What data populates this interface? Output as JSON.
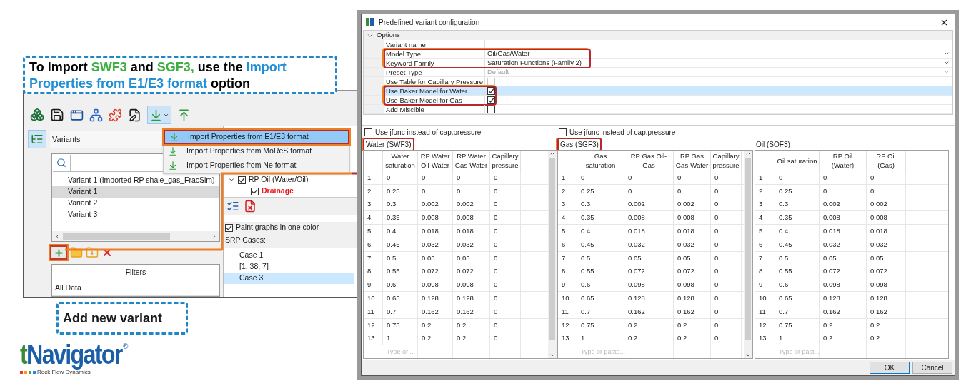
{
  "import_callout": {
    "segments": [
      {
        "text": "To import ",
        "color": "#000000"
      },
      {
        "text": "SWF3",
        "color": "#3cb043"
      },
      {
        "text": " and ",
        "color": "#000000"
      },
      {
        "text": "SGF3,",
        "color": "#3cb043"
      },
      {
        "text": " use the ",
        "color": "#000000"
      },
      {
        "text": "Import Properties from E1/E3 format",
        "color": "#1f8fd6"
      },
      {
        "text": " option",
        "color": "#000000"
      }
    ]
  },
  "add_callout": {
    "text": "Add new variant"
  },
  "app": {
    "import_menu": [
      {
        "label": "Import Properties from E1/E3 format",
        "selected": true
      },
      {
        "label": "Import Properties from MoReS format",
        "selected": false
      },
      {
        "label": "Import Properties from Ne format",
        "selected": false
      }
    ],
    "variants": {
      "title": "Variants",
      "items": [
        {
          "label": "Variant 1 (Imported RP shale_gas_FracSim)",
          "selected": false
        },
        {
          "label": "Variant 1",
          "selected": true
        },
        {
          "label": "Variant 2",
          "selected": false
        },
        {
          "label": "Variant 3",
          "selected": false
        }
      ],
      "add_highlighted": true
    },
    "filters": {
      "header": "Filters",
      "rows": [
        "All Data"
      ]
    },
    "tree": [
      {
        "label": "RP Oil (Water/Oil)",
        "checked": true,
        "expanded": true,
        "children": [
          {
            "label": "Drainage",
            "checked": true,
            "color": "#e8141a"
          }
        ]
      }
    ],
    "paint_one_color": {
      "label": "Paint graphs in one color",
      "checked": true
    },
    "srp_cases": {
      "title": "SRP Cases:",
      "items": [
        {
          "label": "Case 1",
          "selected": false
        },
        {
          "label": "[1, 38, 7]",
          "selected": false
        },
        {
          "label": "Case 3",
          "selected": true
        }
      ]
    }
  },
  "dialog": {
    "title": "Predefined variant configuration",
    "options": {
      "label": "Options",
      "expanded": true
    },
    "option_groups": [
      {
        "highlighted": false,
        "rows": [
          {
            "label": "Variant name",
            "kind": "text",
            "selected": false
          }
        ]
      },
      {
        "highlighted": true,
        "rows": [
          {
            "label": "Model Type",
            "kind": "dropdown",
            "value": "Oil/Gas/Water",
            "disabled": false,
            "selected": false
          },
          {
            "label": "Keyword Family",
            "kind": "dropdown",
            "value": "Saturation Functions (Family 2)",
            "disabled": false,
            "selected": false
          }
        ]
      },
      {
        "highlighted": false,
        "rows": [
          {
            "label": "Preset Type",
            "kind": "dropdown",
            "value": "Default",
            "disabled": true,
            "selected": false
          },
          {
            "label": "Use Table for Capillary Pressure",
            "kind": "checkbox",
            "checked": false,
            "disabled": true,
            "selected": false
          }
        ]
      },
      {
        "highlighted": true,
        "rows": [
          {
            "label": "Use Baker Model for Water",
            "kind": "checkbox",
            "checked": true,
            "disabled": false,
            "selected": true
          },
          {
            "label": "Use Baker Model for Gas",
            "kind": "checkbox",
            "checked": true,
            "disabled": false,
            "selected": false
          }
        ]
      },
      {
        "highlighted": false,
        "rows": [
          {
            "label": "Add Miscible",
            "kind": "checkbox",
            "checked": false,
            "disabled": false,
            "selected": false
          }
        ]
      }
    ],
    "panels": [
      {
        "jfunc": {
          "label": "Use jfunc instead of cap.pressure",
          "checked": false
        },
        "title": "Water (SWF3)",
        "highlighted": true,
        "columns": [
          "",
          "Water saturation",
          "RP Water Oil-Water",
          "RP Water Gas-Water",
          "Capillary pressure"
        ],
        "rows": [
          [
            "1",
            "0",
            "0",
            "0",
            "0"
          ],
          [
            "2",
            "0.25",
            "0",
            "0",
            "0"
          ],
          [
            "3",
            "0.3",
            "0.002",
            "0.002",
            "0"
          ],
          [
            "4",
            "0.35",
            "0.008",
            "0.008",
            "0"
          ],
          [
            "5",
            "0.4",
            "0.018",
            "0.018",
            "0"
          ],
          [
            "6",
            "0.45",
            "0.032",
            "0.032",
            "0"
          ],
          [
            "7",
            "0.5",
            "0.05",
            "0.05",
            "0"
          ],
          [
            "8",
            "0.55",
            "0.072",
            "0.072",
            "0"
          ],
          [
            "9",
            "0.6",
            "0.098",
            "0.098",
            "0"
          ],
          [
            "10",
            "0.65",
            "0.128",
            "0.128",
            "0"
          ],
          [
            "11",
            "0.7",
            "0.162",
            "0.162",
            "0"
          ],
          [
            "12",
            "0.75",
            "0.2",
            "0.2",
            "0"
          ],
          [
            "13",
            "1",
            "0.2",
            "0.2",
            "0"
          ]
        ],
        "new_row_placeholder": "Type or ..."
      },
      {
        "jfunc": {
          "label": "Use jfunc instead of cap.pressure",
          "checked": false
        },
        "title": "Gas (SGF3)",
        "highlighted": true,
        "columns": [
          "",
          "Gas saturation",
          "RP Gas Oil-Gas",
          "RP Gas Gas-Water",
          "Capillary pressure"
        ],
        "rows": [
          [
            "1",
            "0",
            "0",
            "0",
            "0"
          ],
          [
            "2",
            "0.25",
            "0",
            "0",
            "0"
          ],
          [
            "3",
            "0.3",
            "0.002",
            "0.002",
            "0"
          ],
          [
            "4",
            "0.35",
            "0.008",
            "0.008",
            "0"
          ],
          [
            "5",
            "0.4",
            "0.018",
            "0.018",
            "0"
          ],
          [
            "6",
            "0.45",
            "0.032",
            "0.032",
            "0"
          ],
          [
            "7",
            "0.5",
            "0.05",
            "0.05",
            "0"
          ],
          [
            "8",
            "0.55",
            "0.072",
            "0.072",
            "0"
          ],
          [
            "9",
            "0.6",
            "0.098",
            "0.098",
            "0"
          ],
          [
            "10",
            "0.65",
            "0.128",
            "0.128",
            "0"
          ],
          [
            "11",
            "0.7",
            "0.162",
            "0.162",
            "0"
          ],
          [
            "12",
            "0.75",
            "0.2",
            "0.2",
            "0"
          ],
          [
            "13",
            "1",
            "0.2",
            "0.2",
            "0"
          ]
        ],
        "new_row_placeholder": "Type or paste..."
      },
      {
        "title": "Oil (SOF3)",
        "highlighted": false,
        "columns": [
          "",
          "Oil saturation",
          "RP Oil (Water)",
          "RP Oil (Gas)"
        ],
        "rows": [
          [
            "1",
            "0",
            "0",
            "0"
          ],
          [
            "2",
            "0.25",
            "0",
            "0"
          ],
          [
            "3",
            "0.3",
            "0.002",
            "0.002"
          ],
          [
            "4",
            "0.35",
            "0.008",
            "0.008"
          ],
          [
            "5",
            "0.4",
            "0.018",
            "0.018"
          ],
          [
            "6",
            "0.45",
            "0.032",
            "0.032"
          ],
          [
            "7",
            "0.5",
            "0.05",
            "0.05"
          ],
          [
            "8",
            "0.55",
            "0.072",
            "0.072"
          ],
          [
            "9",
            "0.6",
            "0.098",
            "0.098"
          ],
          [
            "10",
            "0.65",
            "0.128",
            "0.128"
          ],
          [
            "11",
            "0.7",
            "0.162",
            "0.162"
          ],
          [
            "12",
            "0.75",
            "0.2",
            "0.2"
          ],
          [
            "13",
            "1",
            "0.2",
            "0.2"
          ]
        ],
        "new_row_placeholder": "Type or past..."
      }
    ],
    "buttons": [
      {
        "label": "OK",
        "default": true
      },
      {
        "label": "Cancel",
        "default": false
      }
    ]
  },
  "logo": {
    "lead": "t",
    "rest": "Navigator",
    "mark": "®",
    "tagline": "Rock Flow Dynamics"
  }
}
